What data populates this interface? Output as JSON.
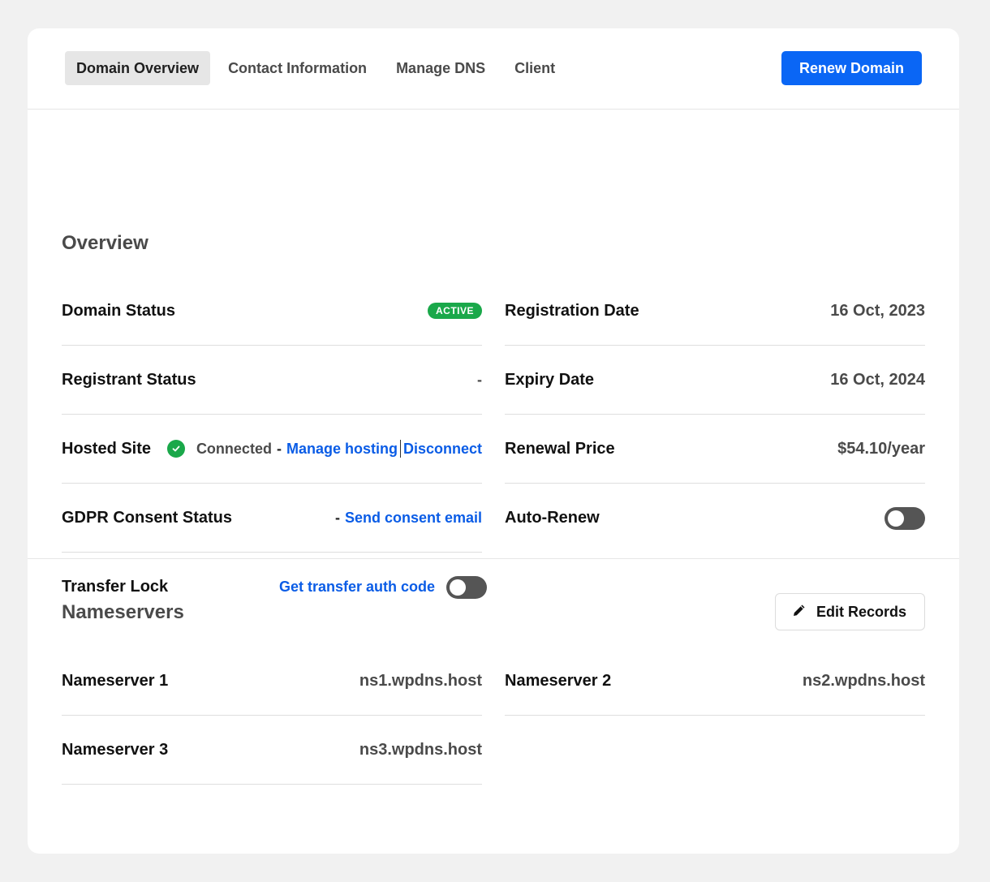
{
  "tabs": [
    "Domain Overview",
    "Contact Information",
    "Manage DNS",
    "Client"
  ],
  "header": {
    "renew_label": "Renew Domain"
  },
  "overview": {
    "title": "Overview",
    "domain_status": {
      "label": "Domain Status",
      "badge": "ACTIVE"
    },
    "registrant_status": {
      "label": "Registrant Status",
      "value": "-"
    },
    "hosted_site": {
      "label": "Hosted Site",
      "status": "Connected",
      "dash": "-",
      "manage_link": "Manage hosting",
      "disconnect_link": "Disconnect"
    },
    "gdpr": {
      "label": "GDPR Consent Status",
      "dash": "-",
      "link": "Send consent email"
    },
    "transfer_lock": {
      "label": "Transfer Lock",
      "link": "Get transfer auth code",
      "enabled": false
    },
    "registration_date": {
      "label": "Registration Date",
      "value": "16 Oct, 2023"
    },
    "expiry_date": {
      "label": "Expiry Date",
      "value": "16 Oct, 2024"
    },
    "renewal_price": {
      "label": "Renewal Price",
      "value": "$54.10/year"
    },
    "auto_renew": {
      "label": "Auto-Renew",
      "enabled": false
    }
  },
  "nameservers": {
    "title": "Nameservers",
    "edit_label": "Edit Records",
    "items": [
      {
        "label": "Nameserver 1",
        "value": "ns1.wpdns.host"
      },
      {
        "label": "Nameserver 2",
        "value": "ns2.wpdns.host"
      },
      {
        "label": "Nameserver 3",
        "value": "ns3.wpdns.host"
      }
    ]
  },
  "colors": {
    "accent": "#0a66f5",
    "link": "#0a5ce6",
    "success": "#1aa84a"
  },
  "icons": [
    "check-circle-icon",
    "pencil-icon"
  ]
}
